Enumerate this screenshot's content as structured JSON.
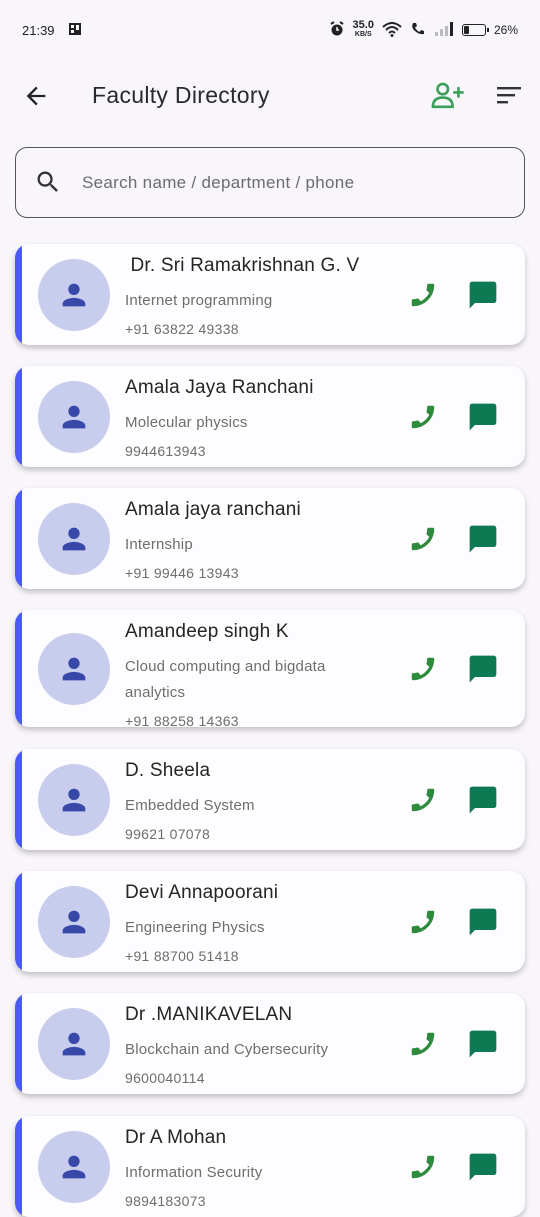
{
  "status_bar": {
    "time": "21:39",
    "net_speed": "35.0",
    "net_unit": "KB/S",
    "battery": "26%",
    "battery_level": 0.26
  },
  "app_bar": {
    "title": "Faculty Directory",
    "icons": [
      "arrow-back-icon",
      "person-add-icon",
      "filter-icon"
    ]
  },
  "search": {
    "placeholder": "Search name / department / phone",
    "value": ""
  },
  "colors": {
    "accent": "#4a5cf0",
    "avatar_bg": "#c8cdee",
    "avatar_icon": "#3848a8",
    "call_icon": "#2e8b3e",
    "message_icon": "#0d7a54",
    "add_person_icon": "#3aa05a"
  },
  "faculty": [
    {
      "name": " Dr. Sri Ramakrishnan G. V",
      "department": "Internet programming",
      "phone": "+91 63822 49338"
    },
    {
      "name": "Amala Jaya Ranchani",
      "department": "Molecular physics",
      "phone": "9944613943"
    },
    {
      "name": "Amala jaya ranchani",
      "department": "Internship",
      "phone": "+91 99446 13943"
    },
    {
      "name": "Amandeep singh K",
      "department": "Cloud computing and bigdata analytics",
      "phone": "+91 88258 14363"
    },
    {
      "name": "D. Sheela",
      "department": "Embedded System",
      "phone": "99621 07078"
    },
    {
      "name": "Devi Annapoorani",
      "department": "Engineering Physics",
      "phone": "+91 88700 51418"
    },
    {
      "name": "Dr .MANIKAVELAN",
      "department": "Blockchain and Cybersecurity",
      "phone": "9600040114"
    },
    {
      "name": "Dr A Mohan",
      "department": "Information Security",
      "phone": "9894183073"
    }
  ]
}
